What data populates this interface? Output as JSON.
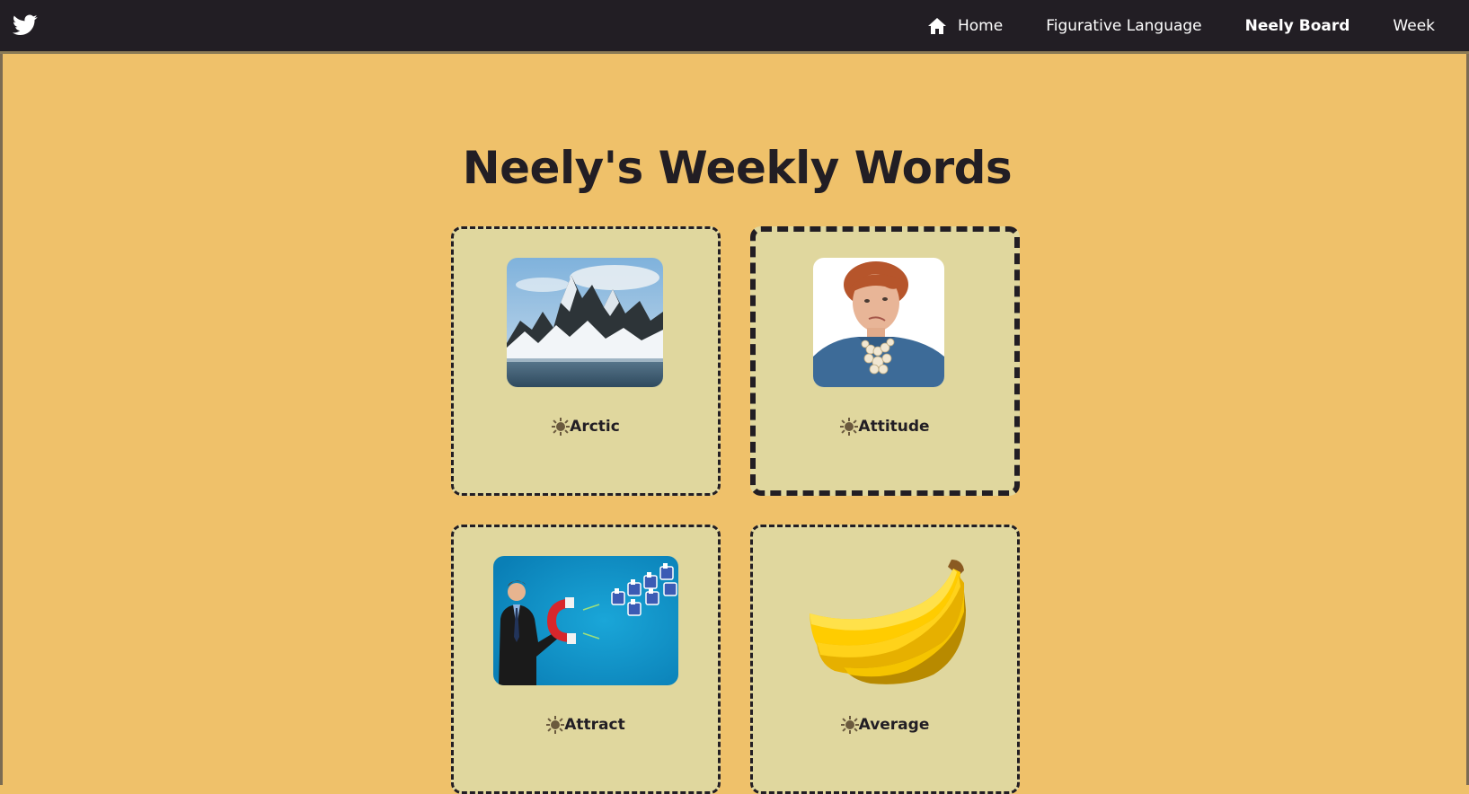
{
  "navbar": {
    "brand_icon": "twitter-bird-icon",
    "links": [
      {
        "label": "Home",
        "icon": "home-icon",
        "active": false
      },
      {
        "label": "Figurative Language",
        "active": false
      },
      {
        "label": "Neely Board",
        "active": true
      },
      {
        "label": "Week",
        "active": false
      }
    ]
  },
  "page": {
    "title": "Neely's Weekly Words"
  },
  "cards": [
    {
      "word": "Arctic",
      "image": "arctic-mountains-image",
      "icon": "sun-icon"
    },
    {
      "word": "Attitude",
      "image": "skeptical-woman-image",
      "icon": "sun-icon"
    },
    {
      "word": "Attract",
      "image": "magnet-attracting-likes-image",
      "icon": "sun-icon"
    },
    {
      "word": "Average",
      "image": "bananas-image",
      "icon": "sun-icon"
    }
  ],
  "colors": {
    "navbar_bg": "#221e24",
    "page_bg": "#efc16a",
    "card_bg": "#e0d79e",
    "text_dark": "#221e24"
  }
}
